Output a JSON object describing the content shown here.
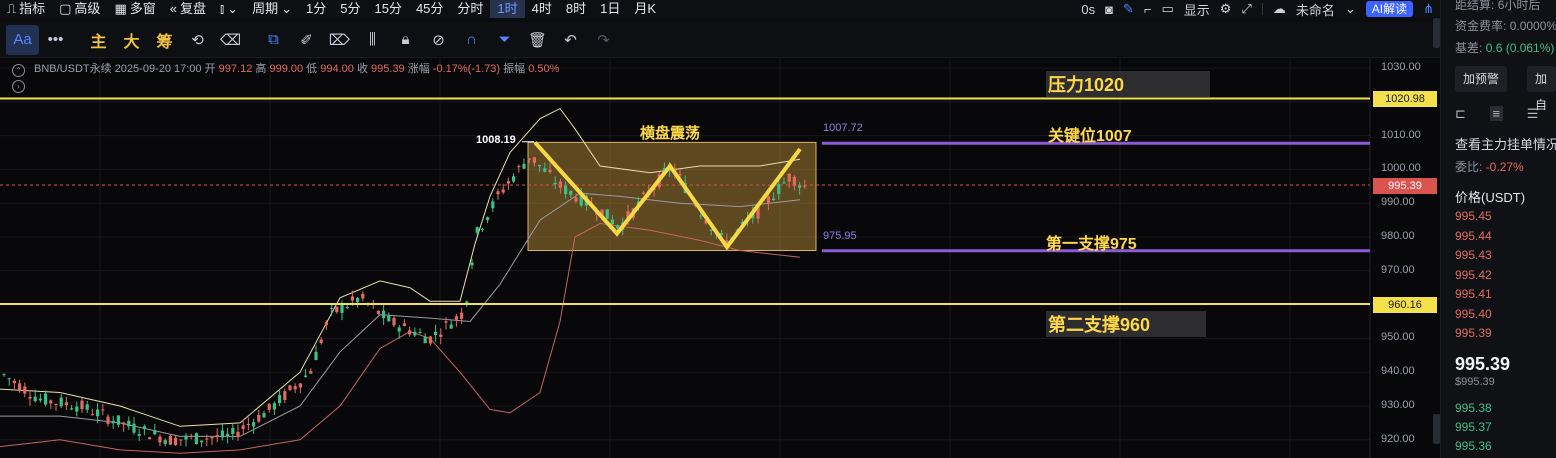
{
  "toolbar": {
    "items": [
      "指标",
      "高级",
      "多窗",
      "复盘",
      "周期"
    ],
    "intervals": [
      "1分",
      "5分",
      "15分",
      "45分",
      "分时",
      "1时",
      "4时",
      "8时",
      "1日",
      "月K"
    ],
    "active_interval": "1时",
    "right": {
      "countdown": "0s",
      "display": "显示",
      "layout_name": "未命名",
      "ai_label": "AI解读"
    }
  },
  "drawbar": {
    "font_btn": "Aa",
    "more": "•••",
    "cn_tools": [
      "主",
      "大",
      "筹"
    ]
  },
  "chart": {
    "ohlc": {
      "symbol": "BNB/USDT永续",
      "datetime": "2025-09-20 17:00",
      "open_label": "开",
      "open": "997.12",
      "high_label": "高",
      "high": "999.00",
      "low_label": "低",
      "low": "994.00",
      "close_label": "收",
      "close": "995.39",
      "change_label": "涨幅",
      "change": "-0.17%(-1.73)",
      "amp_label": "振幅",
      "amp": "0.50%"
    },
    "annotations": {
      "resistance": "压力1020",
      "key_level": "关键位1007",
      "support1": "第一支撑975",
      "support2": "第二支撑960",
      "range": "横盘震荡",
      "box_high": "1008.19",
      "box_top_price": "1007.72",
      "box_bottom_price": "975.95"
    },
    "price_ticks": [
      "1030.00",
      "1010.00",
      "1000.00",
      "990.00",
      "980.00",
      "970.00",
      "950.00",
      "940.00",
      "930.00",
      "920.00"
    ],
    "tags": {
      "resistance": "1020.98",
      "last": "995.39",
      "support": "960.16"
    },
    "colors": {
      "line_yellow": "#f3e04a",
      "line_purple": "#8a5ad8",
      "last_tag": "#d9534f",
      "up": "#3fbf88",
      "down": "#e26b5f"
    }
  },
  "panel": {
    "settle_label": "距结算:",
    "settle_value": "6小时后",
    "funding_label": "资金费率:",
    "funding_value": "0.0000%",
    "basis_label": "基差:",
    "basis_value": "0.6 (0.061%)",
    "btn_alert": "加预警",
    "btn_add": "加自",
    "order_title": "查看主力挂单情况",
    "ratio_label": "委比:",
    "ratio_value": "-0.27%",
    "price_header": "价格(USDT)",
    "asks": [
      "995.45",
      "995.44",
      "995.43",
      "995.42",
      "995.41",
      "995.40",
      "995.39"
    ],
    "last_price": "995.39",
    "last_price_usd": "$995.39",
    "bids": [
      "995.38",
      "995.37",
      "995.36"
    ]
  }
}
